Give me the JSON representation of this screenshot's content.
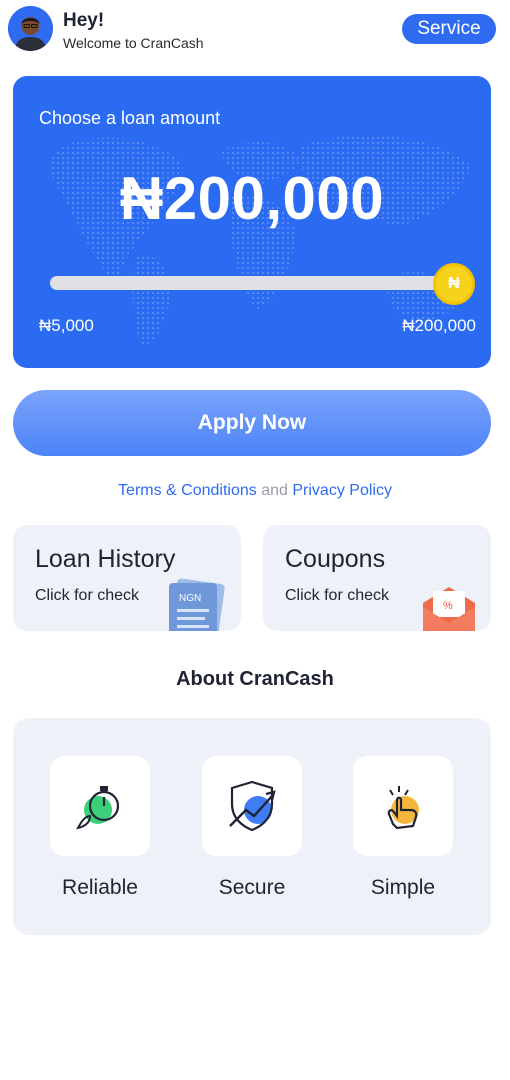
{
  "header": {
    "greeting": "Hey!",
    "welcome": "Welcome to CranCash",
    "service_label": "Service"
  },
  "loan": {
    "label": "Choose a loan amount",
    "amount": "₦200,000",
    "min": "₦5,000",
    "max": "₦200,000",
    "slider_position": 1.0,
    "thumb_glyph": "₦"
  },
  "apply_label": "Apply Now",
  "legal": {
    "terms": "Terms & Conditions",
    "and": "and",
    "privacy": "Privacy Policy"
  },
  "tiles": [
    {
      "title": "Loan History",
      "subtitle": "Click for check",
      "icon": "document-icon",
      "illustration_text": "NGN"
    },
    {
      "title": "Coupons",
      "subtitle": "Click for check",
      "icon": "coupon-icon",
      "illustration_text": "%"
    }
  ],
  "about": {
    "title": "About CranCash",
    "features": [
      {
        "label": "Reliable",
        "icon": "stopwatch-rocket-icon"
      },
      {
        "label": "Secure",
        "icon": "shield-icon"
      },
      {
        "label": "Simple",
        "icon": "tap-hand-icon"
      }
    ]
  },
  "colors": {
    "primary": "#2f6bf0",
    "card_bg": "#2a6bf2",
    "tile_bg": "#eff1f8",
    "coin": "#f7d21a"
  }
}
